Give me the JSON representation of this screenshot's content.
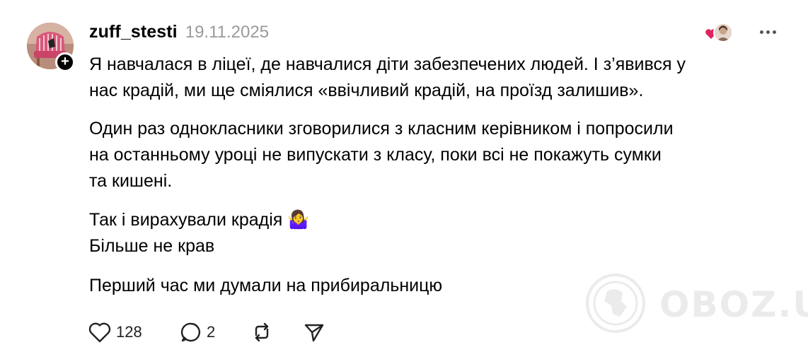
{
  "post": {
    "username": "zuff_stesti",
    "date": "19.11.2025",
    "paragraphs": [
      "Я навчалася в ліцеї, де навчалися діти забезпечених людей. І з’явився у\nнас крадій, ми ще сміялися «ввічливий крадій, на проїзд залишив».",
      "Один раз однокласники зговорилися з класним керівником і попросили\nна останньому уроці не випускати з класу, поки всі не покажуть сумки\nта кишені.",
      "Так і вирахували крадія 🤷‍♀️\nБільше не крав",
      "Перший час ми думали на прибиральницю"
    ]
  },
  "actions": {
    "like_count": "128",
    "reply_count": "2"
  },
  "watermark": {
    "text": "OBOZ.UA"
  },
  "icons": {
    "like": "heart-icon",
    "reply": "speech-bubble-icon",
    "repost": "repost-icon",
    "share": "paper-plane-icon",
    "more": "more-dots-icon",
    "follow": "plus-icon"
  },
  "colors": {
    "text": "#000000",
    "muted": "#9a9a9a",
    "heart": "#e0245e"
  }
}
